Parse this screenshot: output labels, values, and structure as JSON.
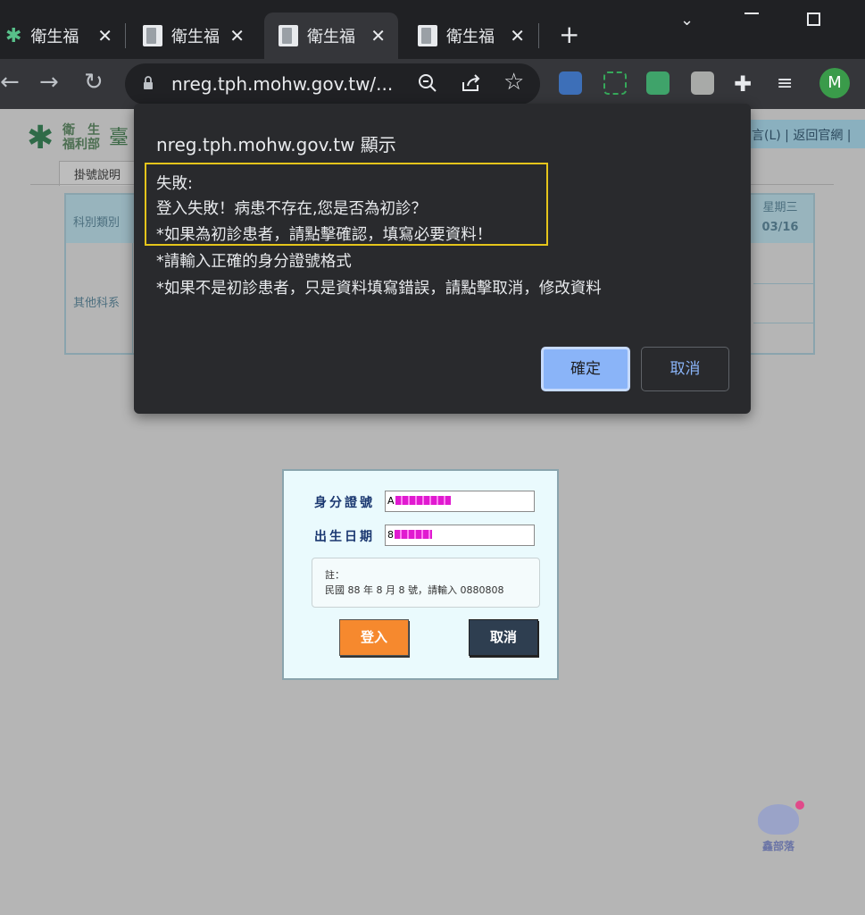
{
  "browser": {
    "tabs": [
      {
        "title": "衛生福",
        "close": "✕"
      },
      {
        "title": "衛生福",
        "close": "✕"
      },
      {
        "title": "衛生福",
        "close": "✕"
      },
      {
        "title": "衛生福",
        "close": "✕"
      }
    ],
    "new_tab": "+",
    "url": "nreg.tph.mohw.gov.tw/...",
    "profile_initial": "M"
  },
  "page": {
    "logo_line1": "衛　生",
    "logo_line2": "福利部",
    "logo_tpe": "臺",
    "top_links": "言(L) | 返回官網 |",
    "nav_tab": "掛號說明",
    "schedule": {
      "dept_header": "科別類別",
      "day_header": "星期三",
      "date_header": "03/16",
      "dept_name": "其他科系"
    },
    "login": {
      "id_label": "身分證號",
      "id_value_prefix": "A",
      "dob_label": "出生日期",
      "dob_value_prefix": "8",
      "note_title": "註：",
      "note_text": "民國 88 年 8 月 8 號，請輸入 0880808",
      "login_button": "登入",
      "cancel_button": "取消"
    },
    "watermark": "鑫部落"
  },
  "dialog": {
    "title": "nreg.tph.mohw.gov.tw 顯示",
    "lines": [
      "失敗:",
      "登入失敗！病患不存在,您是否為初診？",
      "*如果為初診患者，請點擊確認，填寫必要資料！",
      "*請輸入正確的身分證號格式",
      "*如果不是初診患者，只是資料填寫錯誤，請點擊取消，修改資料"
    ],
    "ok_label": "確定",
    "cancel_label": "取消"
  }
}
